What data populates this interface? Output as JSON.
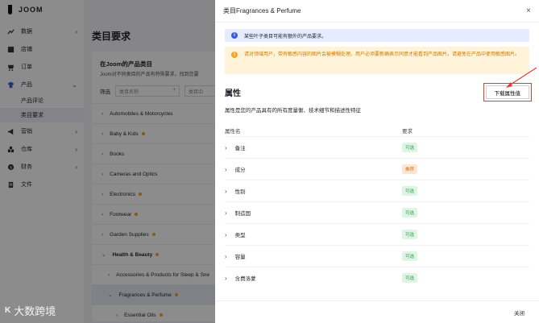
{
  "app": {
    "logo": "JOOM"
  },
  "sidebar": {
    "items": [
      {
        "label": "数据",
        "icon": "chart-icon",
        "chev": "›"
      },
      {
        "label": "店铺",
        "icon": "store-icon"
      },
      {
        "label": "订单",
        "icon": "order-icon"
      },
      {
        "label": "产品",
        "icon": "product-icon",
        "chev": "⌄"
      },
      {
        "label": "营销",
        "icon": "megaphone-icon",
        "chev": "›"
      },
      {
        "label": "仓库",
        "icon": "warehouse-icon",
        "chev": "›"
      },
      {
        "label": "财务",
        "icon": "finance-icon",
        "chev": "›"
      },
      {
        "label": "文件",
        "icon": "file-icon"
      }
    ],
    "sub_items": [
      {
        "label": "产品评论"
      },
      {
        "label": "类目要求"
      }
    ]
  },
  "main": {
    "title": "类目要求",
    "card_title": "在Joom的产品类目",
    "card_sub": "Joom对不同类目的产品有特殊要求，找到您要",
    "filter_label": "筛选",
    "filter_placeholder_1": "类目名称",
    "filter_placeholder_2": "类目ID",
    "categories": [
      {
        "label": "Automobiles & Motorcycles",
        "dot": false
      },
      {
        "label": "Baby & Kids",
        "dot": true
      },
      {
        "label": "Books",
        "dot": false
      },
      {
        "label": "Cameras and Optics",
        "dot": false
      },
      {
        "label": "Electronics",
        "dot": true
      },
      {
        "label": "Footwear",
        "dot": true
      },
      {
        "label": "Garden Supplies",
        "dot": true
      },
      {
        "label": "Health & Beauty",
        "dot": true
      },
      {
        "label": "Accessories & Products for Sleep & Sne",
        "dot": false
      },
      {
        "label": "Fragrances & Perfume",
        "dot": true
      },
      {
        "label": "Essential Oils",
        "dot": true
      }
    ]
  },
  "drawer": {
    "title": "类目Fragrances & Perfume",
    "close": "×",
    "info": "某些叶子类目可能有额外的产品要求。",
    "warning": "请对领域用户，带有敏感内容的图片会被模糊处理。用户必须要新确表示同意才能看到产品图片。请避免在产品中使用敏感图片。",
    "attr_title": "属性",
    "download_btn": "下载属性值",
    "attr_desc": "属性是您的产品具有的所有度量衡、技术细节和描述性特征",
    "col_name": "属性名",
    "col_req": "要求",
    "rows": [
      {
        "name": "备注",
        "req": "可选",
        "type": "opt"
      },
      {
        "name": "成分",
        "req": "推荐",
        "type": "rec"
      },
      {
        "name": "性别",
        "req": "可选",
        "type": "opt"
      },
      {
        "name": "制造国",
        "req": "可选",
        "type": "opt"
      },
      {
        "name": "类型",
        "req": "可选",
        "type": "opt"
      },
      {
        "name": "容量",
        "req": "可选",
        "type": "opt"
      },
      {
        "name": "含费洛蒙",
        "req": "可选",
        "type": "opt"
      }
    ],
    "footer_close": "关闭"
  },
  "watermark": {
    "text": "大数跨境",
    "mark": "K"
  },
  "colors": {
    "accent": "#3b5bdb",
    "warning": "#f5a623",
    "annotation": "#e53935"
  }
}
